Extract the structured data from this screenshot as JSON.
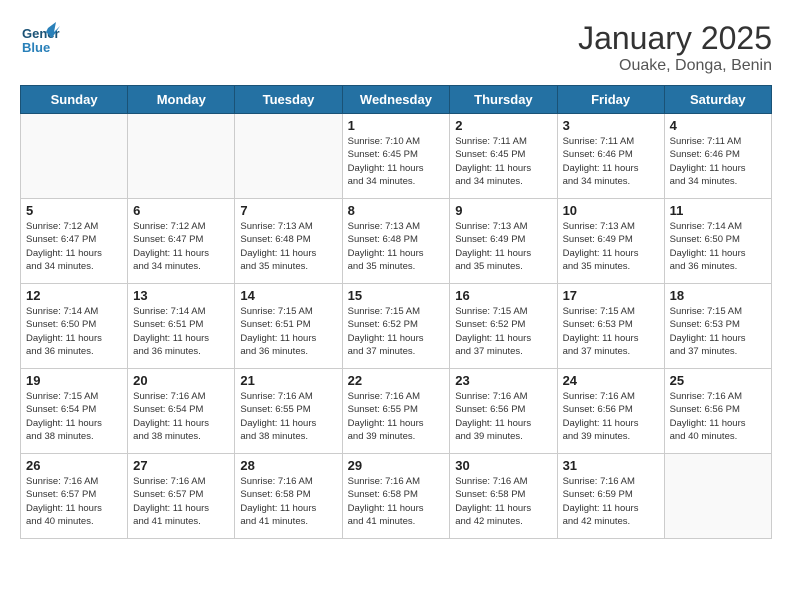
{
  "header": {
    "logo_general": "General",
    "logo_blue": "Blue",
    "title": "January 2025",
    "subtitle": "Ouake, Donga, Benin"
  },
  "days_of_week": [
    "Sunday",
    "Monday",
    "Tuesday",
    "Wednesday",
    "Thursday",
    "Friday",
    "Saturday"
  ],
  "weeks": [
    [
      {
        "day": "",
        "info": ""
      },
      {
        "day": "",
        "info": ""
      },
      {
        "day": "",
        "info": ""
      },
      {
        "day": "1",
        "info": "Sunrise: 7:10 AM\nSunset: 6:45 PM\nDaylight: 11 hours\nand 34 minutes."
      },
      {
        "day": "2",
        "info": "Sunrise: 7:11 AM\nSunset: 6:45 PM\nDaylight: 11 hours\nand 34 minutes."
      },
      {
        "day": "3",
        "info": "Sunrise: 7:11 AM\nSunset: 6:46 PM\nDaylight: 11 hours\nand 34 minutes."
      },
      {
        "day": "4",
        "info": "Sunrise: 7:11 AM\nSunset: 6:46 PM\nDaylight: 11 hours\nand 34 minutes."
      }
    ],
    [
      {
        "day": "5",
        "info": "Sunrise: 7:12 AM\nSunset: 6:47 PM\nDaylight: 11 hours\nand 34 minutes."
      },
      {
        "day": "6",
        "info": "Sunrise: 7:12 AM\nSunset: 6:47 PM\nDaylight: 11 hours\nand 34 minutes."
      },
      {
        "day": "7",
        "info": "Sunrise: 7:13 AM\nSunset: 6:48 PM\nDaylight: 11 hours\nand 35 minutes."
      },
      {
        "day": "8",
        "info": "Sunrise: 7:13 AM\nSunset: 6:48 PM\nDaylight: 11 hours\nand 35 minutes."
      },
      {
        "day": "9",
        "info": "Sunrise: 7:13 AM\nSunset: 6:49 PM\nDaylight: 11 hours\nand 35 minutes."
      },
      {
        "day": "10",
        "info": "Sunrise: 7:13 AM\nSunset: 6:49 PM\nDaylight: 11 hours\nand 35 minutes."
      },
      {
        "day": "11",
        "info": "Sunrise: 7:14 AM\nSunset: 6:50 PM\nDaylight: 11 hours\nand 36 minutes."
      }
    ],
    [
      {
        "day": "12",
        "info": "Sunrise: 7:14 AM\nSunset: 6:50 PM\nDaylight: 11 hours\nand 36 minutes."
      },
      {
        "day": "13",
        "info": "Sunrise: 7:14 AM\nSunset: 6:51 PM\nDaylight: 11 hours\nand 36 minutes."
      },
      {
        "day": "14",
        "info": "Sunrise: 7:15 AM\nSunset: 6:51 PM\nDaylight: 11 hours\nand 36 minutes."
      },
      {
        "day": "15",
        "info": "Sunrise: 7:15 AM\nSunset: 6:52 PM\nDaylight: 11 hours\nand 37 minutes."
      },
      {
        "day": "16",
        "info": "Sunrise: 7:15 AM\nSunset: 6:52 PM\nDaylight: 11 hours\nand 37 minutes."
      },
      {
        "day": "17",
        "info": "Sunrise: 7:15 AM\nSunset: 6:53 PM\nDaylight: 11 hours\nand 37 minutes."
      },
      {
        "day": "18",
        "info": "Sunrise: 7:15 AM\nSunset: 6:53 PM\nDaylight: 11 hours\nand 37 minutes."
      }
    ],
    [
      {
        "day": "19",
        "info": "Sunrise: 7:15 AM\nSunset: 6:54 PM\nDaylight: 11 hours\nand 38 minutes."
      },
      {
        "day": "20",
        "info": "Sunrise: 7:16 AM\nSunset: 6:54 PM\nDaylight: 11 hours\nand 38 minutes."
      },
      {
        "day": "21",
        "info": "Sunrise: 7:16 AM\nSunset: 6:55 PM\nDaylight: 11 hours\nand 38 minutes."
      },
      {
        "day": "22",
        "info": "Sunrise: 7:16 AM\nSunset: 6:55 PM\nDaylight: 11 hours\nand 39 minutes."
      },
      {
        "day": "23",
        "info": "Sunrise: 7:16 AM\nSunset: 6:56 PM\nDaylight: 11 hours\nand 39 minutes."
      },
      {
        "day": "24",
        "info": "Sunrise: 7:16 AM\nSunset: 6:56 PM\nDaylight: 11 hours\nand 39 minutes."
      },
      {
        "day": "25",
        "info": "Sunrise: 7:16 AM\nSunset: 6:56 PM\nDaylight: 11 hours\nand 40 minutes."
      }
    ],
    [
      {
        "day": "26",
        "info": "Sunrise: 7:16 AM\nSunset: 6:57 PM\nDaylight: 11 hours\nand 40 minutes."
      },
      {
        "day": "27",
        "info": "Sunrise: 7:16 AM\nSunset: 6:57 PM\nDaylight: 11 hours\nand 41 minutes."
      },
      {
        "day": "28",
        "info": "Sunrise: 7:16 AM\nSunset: 6:58 PM\nDaylight: 11 hours\nand 41 minutes."
      },
      {
        "day": "29",
        "info": "Sunrise: 7:16 AM\nSunset: 6:58 PM\nDaylight: 11 hours\nand 41 minutes."
      },
      {
        "day": "30",
        "info": "Sunrise: 7:16 AM\nSunset: 6:58 PM\nDaylight: 11 hours\nand 42 minutes."
      },
      {
        "day": "31",
        "info": "Sunrise: 7:16 AM\nSunset: 6:59 PM\nDaylight: 11 hours\nand 42 minutes."
      },
      {
        "day": "",
        "info": ""
      }
    ]
  ]
}
